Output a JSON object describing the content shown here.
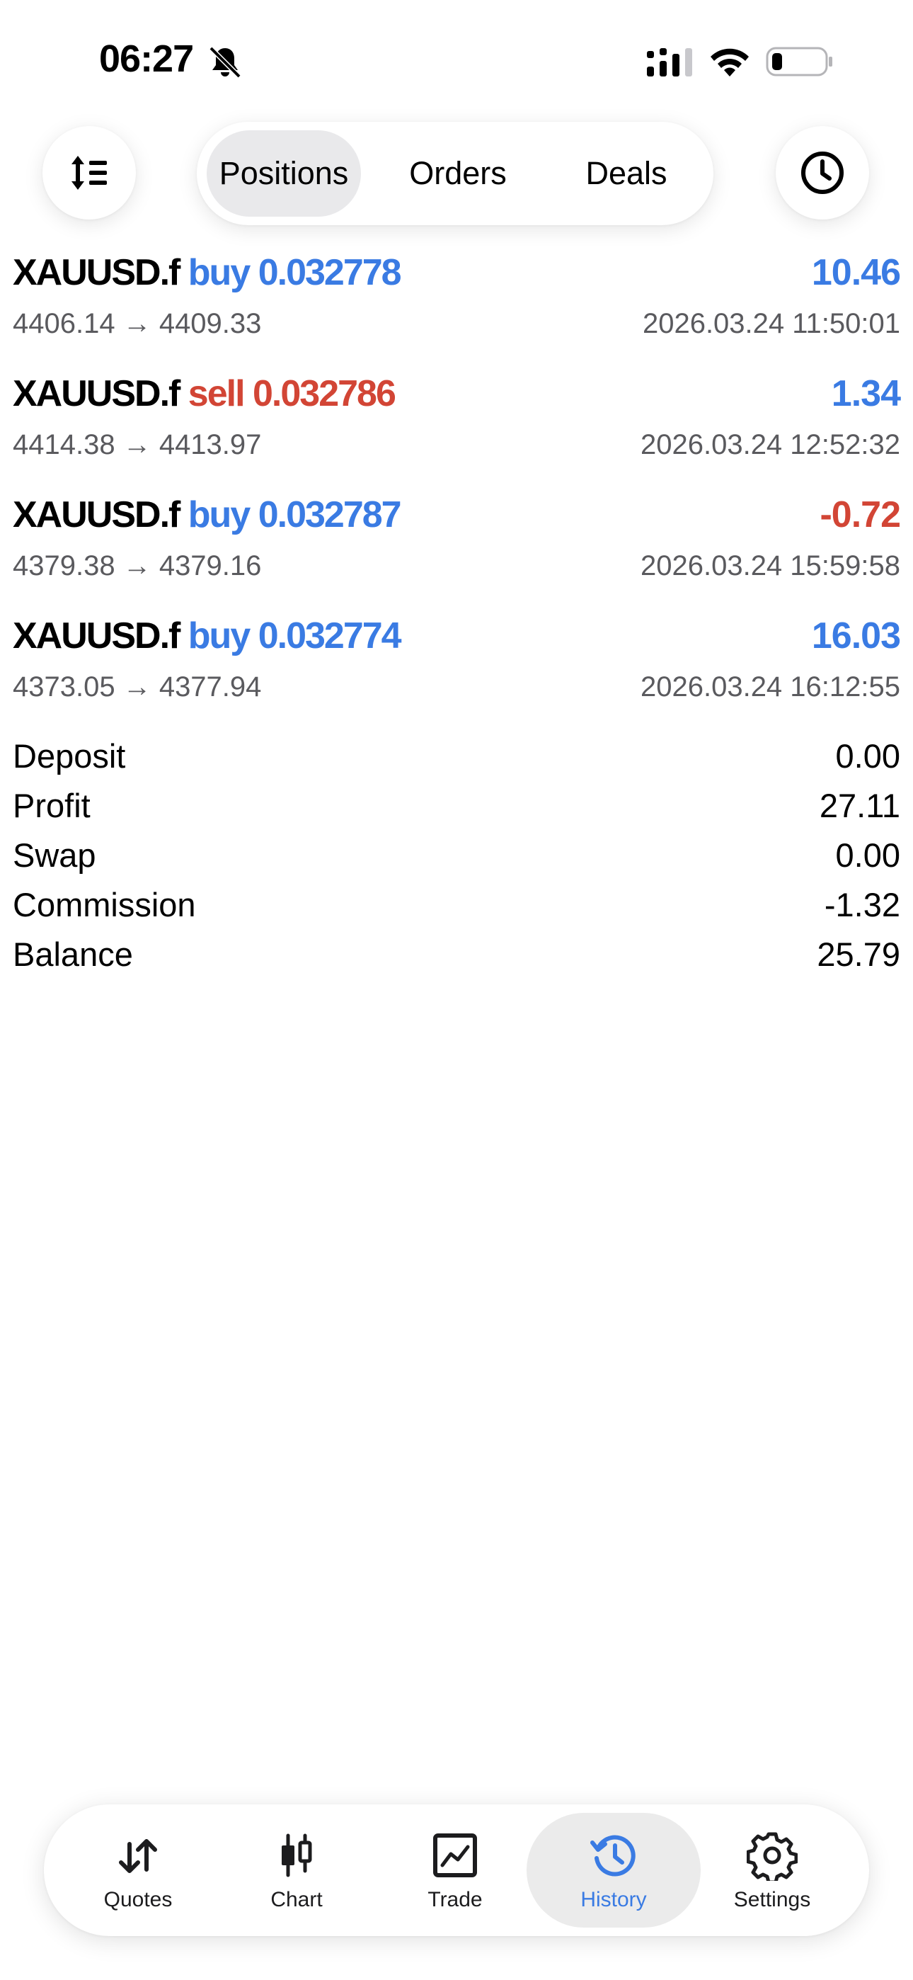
{
  "status_bar": {
    "time": "06:27"
  },
  "tabs": [
    "Positions",
    "Orders",
    "Deals"
  ],
  "active_tab": "Positions",
  "positions": [
    {
      "symbol": "XAUUSD.f",
      "side": "buy",
      "volume": "0.032778",
      "prices": "4406.14 → 4409.33",
      "profit": "10.46",
      "time": "2026.03.24 11:50:01"
    },
    {
      "symbol": "XAUUSD.f",
      "side": "sell",
      "volume": "0.032786",
      "prices": "4414.38 → 4413.97",
      "profit": "1.34",
      "time": "2026.03.24 12:52:32"
    },
    {
      "symbol": "XAUUSD.f",
      "side": "buy",
      "volume": "0.032787",
      "prices": "4379.38 → 4379.16",
      "profit": "-0.72",
      "time": "2026.03.24 15:59:58"
    },
    {
      "symbol": "XAUUSD.f",
      "side": "buy",
      "volume": "0.032774",
      "prices": "4373.05 → 4377.94",
      "profit": "16.03",
      "time": "2026.03.24 16:12:55"
    }
  ],
  "summary": [
    {
      "label": "Deposit",
      "value": "0.00"
    },
    {
      "label": "Profit",
      "value": "27.11"
    },
    {
      "label": "Swap",
      "value": "0.00"
    },
    {
      "label": "Commission",
      "value": "-1.32"
    },
    {
      "label": "Balance",
      "value": "25.79"
    }
  ],
  "bottom_nav": [
    {
      "label": "Quotes",
      "icon": "quotes-arrows-icon"
    },
    {
      "label": "Chart",
      "icon": "candlestick-chart-icon"
    },
    {
      "label": "Trade",
      "icon": "trade-chart-icon"
    },
    {
      "label": "History",
      "icon": "history-clock-icon"
    },
    {
      "label": "Settings",
      "icon": "gear-icon"
    }
  ],
  "active_nav": "History",
  "colors": {
    "accent_blue": "#3a7be3",
    "sell_red": "#d24535",
    "secondary_text": "#5a5a5e",
    "active_pill": "#e9e9eb"
  }
}
